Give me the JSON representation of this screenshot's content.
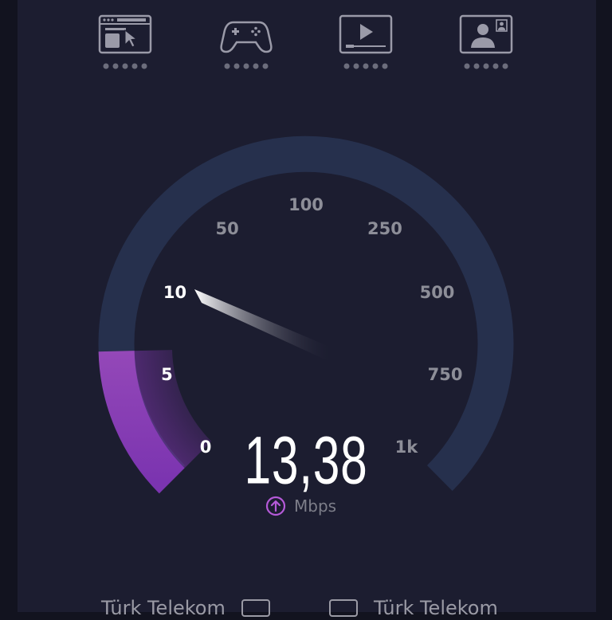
{
  "test_types": [
    {
      "name": "web browsing",
      "icon": "browser-icon",
      "dots": 5
    },
    {
      "name": "gaming",
      "icon": "gamepad-icon",
      "dots": 5
    },
    {
      "name": "video streaming",
      "icon": "video-play-icon",
      "dots": 5
    },
    {
      "name": "video calling",
      "icon": "video-call-icon",
      "dots": 5
    }
  ],
  "gauge": {
    "scale": [
      "0",
      "5",
      "10",
      "50",
      "100",
      "250",
      "500",
      "750",
      "1k"
    ],
    "current_reading": 13.38,
    "active_color": "#8e44ad",
    "track_color": "#26304d",
    "label_color": "#8d8e98",
    "active_label_color": "#ffffff"
  },
  "speed": {
    "value": "13,38",
    "unit": "Mbps",
    "direction_icon": "upload-arrow-icon",
    "accent": "#b55ad8"
  },
  "footer": {
    "left_provider": "Türk Telekom",
    "right_provider": "Türk Telekom"
  }
}
